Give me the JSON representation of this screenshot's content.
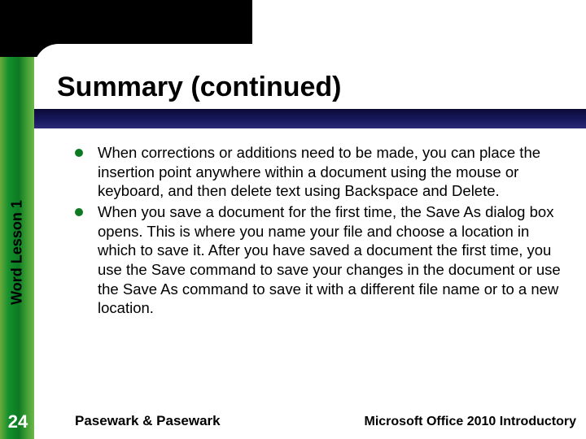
{
  "title": "Summary (continued)",
  "sidebar_label": "Word Lesson 1",
  "page_number": "24",
  "bullets": [
    "When corrections or additions need to be made, you can place the insertion point anywhere within a document using the mouse or keyboard, and then delete text using Backspace and Delete.",
    "When you save a document for the first time, the Save As dialog box opens. This is where you name your file and choose a location in which to save it. After you have saved a document the first time, you use the Save command to save your changes in the document or use the Save As command to save it with a different file name or to a new location."
  ],
  "footer_left": "Pasewark & Pasewark",
  "footer_right": "Microsoft Office 2010 Introductory"
}
